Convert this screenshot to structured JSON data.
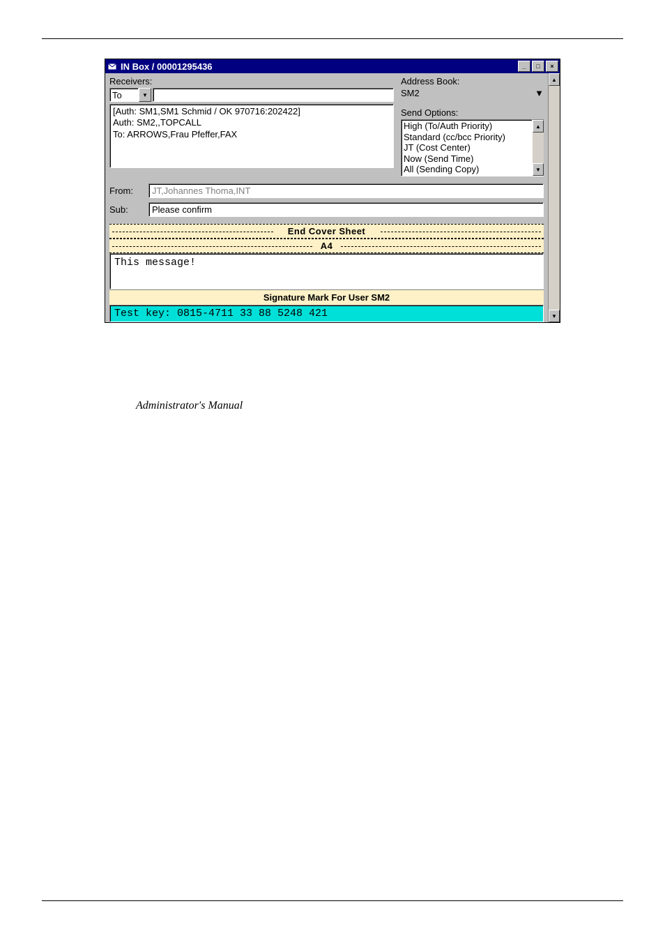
{
  "window": {
    "title": "IN Box / 00001295436"
  },
  "labels": {
    "receivers": "Receivers:",
    "address_book": "Address Book:",
    "send_options": "Send Options:",
    "from": "From:",
    "sub": "Sub:"
  },
  "receivers": {
    "type_selected": "To",
    "body": "[Auth: SM1,SM1 Schmid / OK 970716:202422]\nAuth: SM2,,TOPCALL\nTo: ARROWS,Frau Pfeffer,FAX"
  },
  "address_book": {
    "selected": "SM2"
  },
  "send_options": {
    "items": [
      "High   (To/Auth Priority)",
      "Standard   (cc/bcc Priority)",
      "JT   (Cost Center)",
      "Now   (Send Time)",
      "All   (Sending Copy)"
    ]
  },
  "from_value": "JT,Johannes Thoma,INT",
  "sub_value": "Please confirm",
  "separators": {
    "end_cover": "End Cover Sheet",
    "a4": "A4"
  },
  "message_body": "This message!",
  "signature_band": "Signature Mark For User SM2",
  "test_key": "Test key: 0815-4711 33 88 5248 421",
  "footnote": "Administrator's Manual"
}
